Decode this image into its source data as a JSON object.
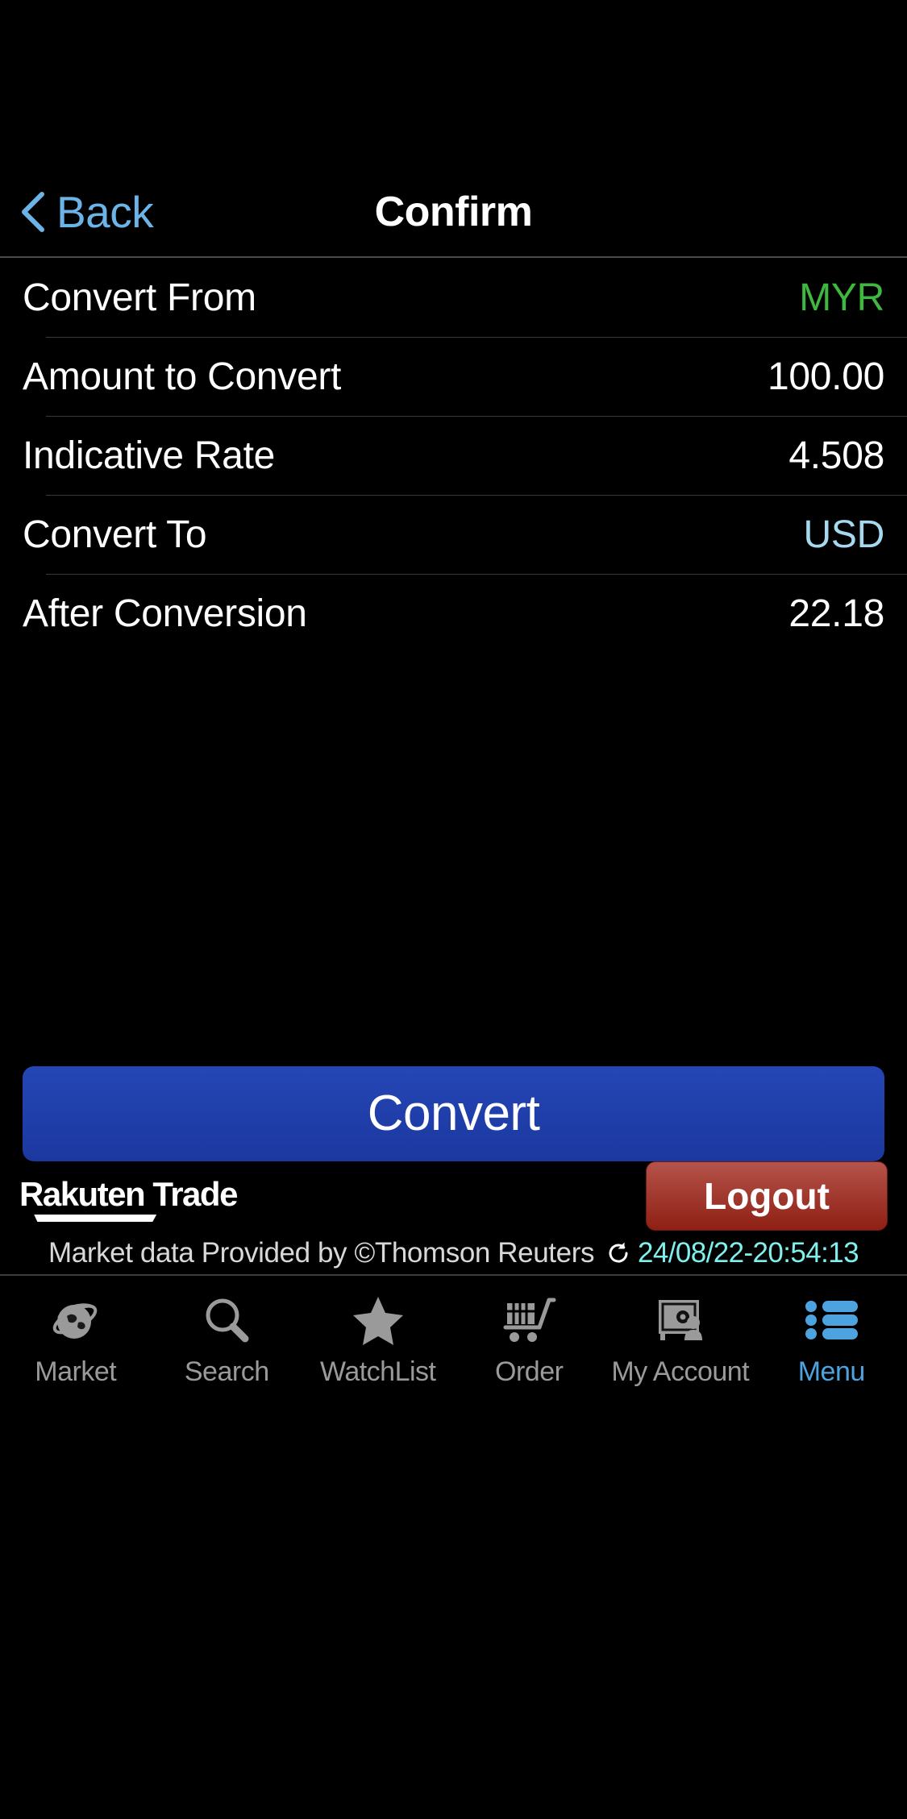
{
  "statusbar": {
    "present": true
  },
  "header": {
    "back_label": "Back",
    "title": "Confirm",
    "back_icon": "chevron-left-icon"
  },
  "details": {
    "rows": [
      {
        "label": "Convert From",
        "value": "MYR",
        "value_style": "green"
      },
      {
        "label": "Amount to Convert",
        "value": "100.00",
        "value_style": "plain"
      },
      {
        "label": "Indicative Rate",
        "value": "4.508",
        "value_style": "plain"
      },
      {
        "label": "Convert To",
        "value": "USD",
        "value_style": "blue"
      },
      {
        "label": "After Conversion",
        "value": "22.18",
        "value_style": "plain"
      }
    ]
  },
  "action": {
    "convert_label": "Convert"
  },
  "footer": {
    "brand": "Rakuten Trade",
    "logout_label": "Logout",
    "disclaimer": "Market data Provided by ©Thomson Reuters",
    "timestamp": "24/08/22-20:54:13",
    "refresh_icon": "refresh-icon"
  },
  "tabbar": {
    "items": [
      {
        "label": "Market",
        "icon": "globe-icon",
        "active": false
      },
      {
        "label": "Search",
        "icon": "magnifier-icon",
        "active": false
      },
      {
        "label": "WatchList",
        "icon": "star-icon",
        "active": false
      },
      {
        "label": "Order",
        "icon": "shopping-cart-icon",
        "active": false
      },
      {
        "label": "My Account",
        "icon": "safe-vault-icon",
        "active": false
      },
      {
        "label": "Menu",
        "icon": "list-menu-icon",
        "active": true
      }
    ]
  },
  "colors": {
    "background": "#000000",
    "accent_blue": "#6cb3e8",
    "value_green": "#3fb83f",
    "value_blue": "#a6d8f0",
    "convert_button": "#2446b5",
    "logout_button": "#8e1f14",
    "timestamp_cyan": "#7ff0ee",
    "tab_inactive": "#9a9a9a",
    "tab_active": "#4da3e0",
    "separator": "#3a3a3a"
  }
}
